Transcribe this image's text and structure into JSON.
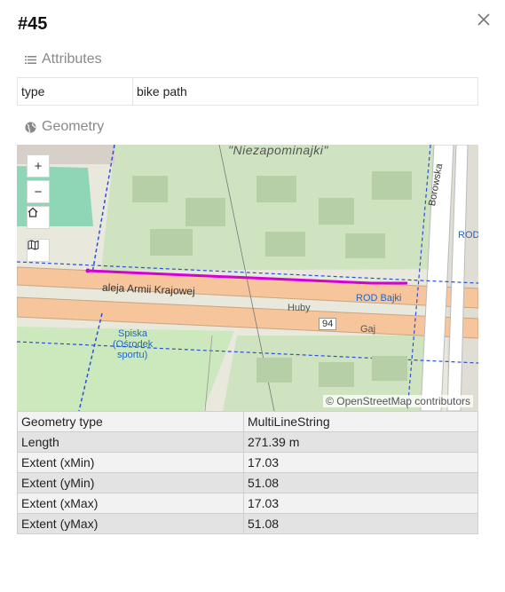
{
  "title": "#45",
  "attributes": {
    "heading": "Attributes",
    "rows": [
      {
        "key": "type",
        "value": "bike path"
      }
    ]
  },
  "geometry": {
    "heading": "Geometry",
    "map": {
      "labels": {
        "area": "\"Niezapominajki\"",
        "street_main": "aleja Armii Krajowej",
        "street_side": "Borowska",
        "stop_rod_bajki": "ROD Bajki",
        "stop_rod": "ROD",
        "huby": "Huby",
        "gaj": "Gaj",
        "route": "94",
        "spiska": "Spiska",
        "osrodek": "(Ośrodek",
        "sportu": "sportu)"
      },
      "attribution": "© OpenStreetMap contributors",
      "controls": {
        "zoom_in": "+",
        "zoom_out": "−"
      }
    },
    "rows": [
      {
        "key": "Geometry type",
        "value": "MultiLineString"
      },
      {
        "key": "Length",
        "value": "271.39 m"
      },
      {
        "key": "Extent (xMin)",
        "value": "17.03"
      },
      {
        "key": "Extent (yMin)",
        "value": "51.08"
      },
      {
        "key": "Extent (xMax)",
        "value": "17.03"
      },
      {
        "key": "Extent (yMax)",
        "value": "51.08"
      }
    ]
  },
  "colors": {
    "road": "#f6c59c",
    "garden": "#cfe3c1",
    "track": "#d400d4",
    "pitch": "#8fd6b7"
  }
}
